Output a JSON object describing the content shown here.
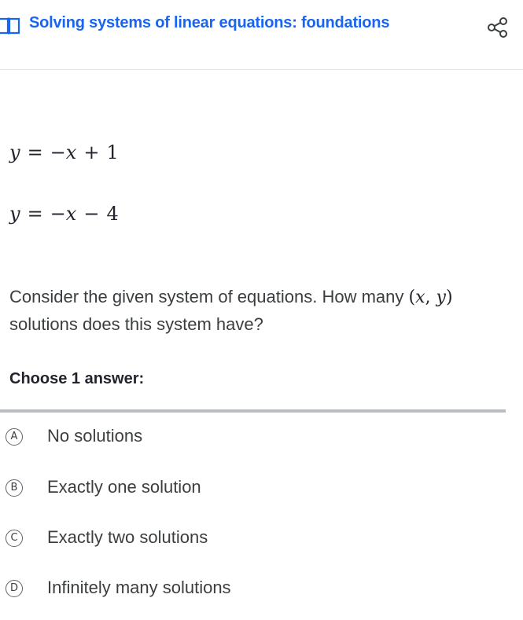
{
  "header": {
    "title": "Solving systems of linear equations: foundations",
    "icon_left": "book-icon",
    "icon_right": "share-icon",
    "accent_color": "#1865f2"
  },
  "equations": [
    {
      "lhs": "y",
      "eq": "=",
      "neg": "−",
      "var": "x",
      "op": "+",
      "const": "1"
    },
    {
      "lhs": "y",
      "eq": "=",
      "neg": "−",
      "var": "x",
      "op": "−",
      "const": "4"
    }
  ],
  "question": {
    "text_before": "Consider the given system of equations. How many ",
    "math": {
      "open": "(",
      "x": "x",
      "comma": ", ",
      "y": "y",
      "close": ")"
    },
    "text_after": " solutions does this system have?"
  },
  "instructions": "Choose 1 answer:",
  "choices": [
    {
      "letter": "A",
      "label": "No solutions"
    },
    {
      "letter": "B",
      "label": "Exactly one solution"
    },
    {
      "letter": "C",
      "label": "Exactly two solutions"
    },
    {
      "letter": "D",
      "label": "Infinitely many solutions"
    }
  ]
}
